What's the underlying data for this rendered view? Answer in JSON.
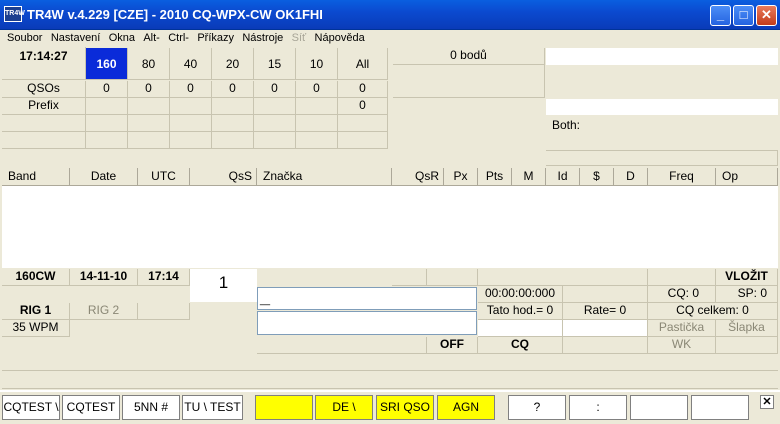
{
  "window": {
    "title": "TR4W v.4.229 [CZE] - 2010 CQ-WPX-CW OK1FHI",
    "icon_label": "TR4W"
  },
  "window_controls": {
    "minimize": "_",
    "maximize": "□",
    "close": "✕"
  },
  "menu": [
    {
      "label": "Soubor",
      "enabled": true
    },
    {
      "label": "Nastavení",
      "enabled": true
    },
    {
      "label": "Okna",
      "enabled": true
    },
    {
      "label": "Alt-",
      "enabled": true
    },
    {
      "label": "Ctrl-",
      "enabled": true
    },
    {
      "label": "Příkazy",
      "enabled": true
    },
    {
      "label": "Nástroje",
      "enabled": true
    },
    {
      "label": "Síť",
      "enabled": false
    },
    {
      "label": "Nápověda",
      "enabled": true
    }
  ],
  "summary": {
    "clock": "17:14:27",
    "bands": [
      "160",
      "80",
      "40",
      "20",
      "15",
      "10",
      "All"
    ],
    "selected_band": "160",
    "qsos_label": "QSOs",
    "qsos": [
      "0",
      "0",
      "0",
      "0",
      "0",
      "0",
      "0"
    ],
    "prefix_label": "Prefix",
    "prefix_all": "0",
    "points": "0 bodů",
    "both_label": "Both:"
  },
  "log_columns": [
    "Band",
    "Date",
    "UTC",
    "QsS",
    "Značka",
    "QsR",
    "Px",
    "Pts",
    "M",
    "Id",
    "$",
    "D",
    "Freq",
    "Op"
  ],
  "entry": {
    "band_mode": "160CW",
    "date": "14-11-10",
    "time": "17:14",
    "qso_number": "1",
    "call_value": "_",
    "timer": "00:00:00:000",
    "cq_count": "CQ: 0",
    "sp_count": "SP: 0",
    "insert_label": "VLOŽIT",
    "rig1": "RIG 1",
    "rig2": "RIG 2",
    "wpm": "35 WPM",
    "this_hour": "Tato hod.= 0",
    "rate": "Rate= 0",
    "cq_total": "CQ celkem: 0",
    "pasticka": "Pastička",
    "slapka": "Šlapka",
    "off": "OFF",
    "cq_mode": "CQ",
    "wk": "WK"
  },
  "function_keys": [
    {
      "label": "CQTEST \\",
      "color": "#ffffff"
    },
    {
      "label": "CQTEST",
      "color": "#ffffff"
    },
    {
      "label": "5NN #",
      "color": "#ffffff"
    },
    {
      "label": "TU \\ TEST",
      "color": "#ffffff"
    },
    {
      "label": "",
      "color": "#ffff00"
    },
    {
      "label": "DE \\",
      "color": "#ffff00"
    },
    {
      "label": "SRI QSO",
      "color": "#ffff00"
    },
    {
      "label": "AGN",
      "color": "#ffff00"
    },
    {
      "label": "?",
      "color": "#ffffff"
    },
    {
      "label": ":",
      "color": "#ffffff"
    },
    {
      "label": "",
      "color": "#ffffff"
    },
    {
      "label": "",
      "color": "#ffffff"
    }
  ],
  "fkey_close": "✕"
}
